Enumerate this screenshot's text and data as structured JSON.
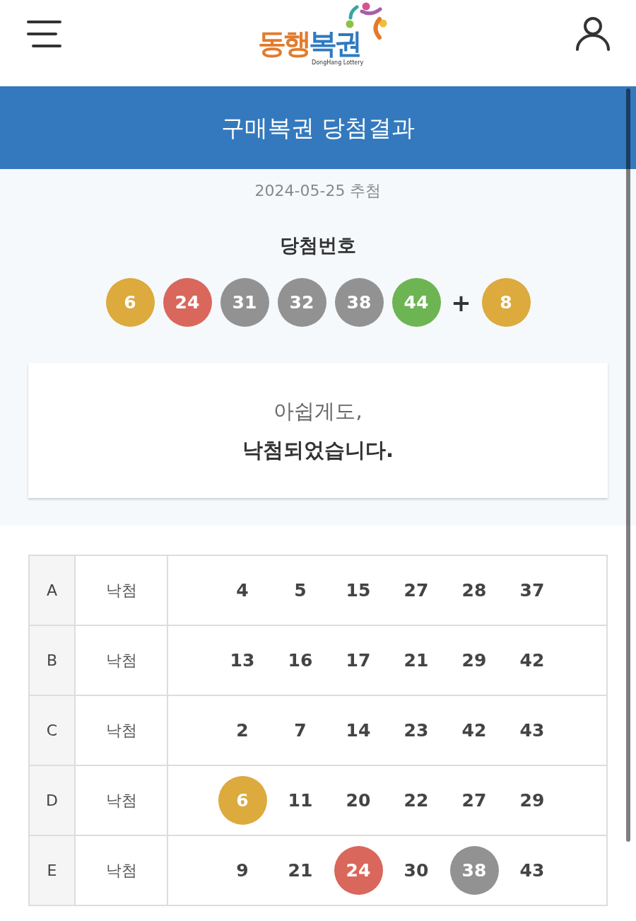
{
  "header": {
    "logo": {
      "wordmark": [
        {
          "text": "동행",
          "color": "#e27b2c"
        },
        {
          "text": "복권",
          "color": "#2f7ac1"
        }
      ],
      "subtitle": "DongHang Lottery"
    }
  },
  "page_title": "구매복권 당첨결과",
  "draw": {
    "date": "2024-05-25 추첨",
    "title": "당첨번호",
    "balls": [
      {
        "number": "6",
        "color": "#dcaa3d"
      },
      {
        "number": "24",
        "color": "#d9675b"
      },
      {
        "number": "31",
        "color": "#929292"
      },
      {
        "number": "32",
        "color": "#929292"
      },
      {
        "number": "38",
        "color": "#929292"
      },
      {
        "number": "44",
        "color": "#6db453"
      }
    ],
    "plus": "+",
    "bonus": {
      "number": "8",
      "color": "#dcaa3d"
    }
  },
  "result_card": {
    "line_1": "아쉽게도,",
    "line_2": "낙첨되었습니다."
  },
  "tickets": [
    {
      "game": "A",
      "result": "낙첨",
      "numbers": [
        {
          "value": "4"
        },
        {
          "value": "5"
        },
        {
          "value": "15"
        },
        {
          "value": "27"
        },
        {
          "value": "28"
        },
        {
          "value": "37"
        }
      ]
    },
    {
      "game": "B",
      "result": "낙첨",
      "numbers": [
        {
          "value": "13"
        },
        {
          "value": "16"
        },
        {
          "value": "17"
        },
        {
          "value": "21"
        },
        {
          "value": "29"
        },
        {
          "value": "42"
        }
      ]
    },
    {
      "game": "C",
      "result": "낙첨",
      "numbers": [
        {
          "value": "2"
        },
        {
          "value": "7"
        },
        {
          "value": "14"
        },
        {
          "value": "23"
        },
        {
          "value": "42"
        },
        {
          "value": "43"
        }
      ]
    },
    {
      "game": "D",
      "result": "낙첨",
      "numbers": [
        {
          "value": "6",
          "color": "#dcaa3d"
        },
        {
          "value": "11"
        },
        {
          "value": "20"
        },
        {
          "value": "22"
        },
        {
          "value": "27"
        },
        {
          "value": "29"
        }
      ]
    },
    {
      "game": "E",
      "result": "낙첨",
      "numbers": [
        {
          "value": "9"
        },
        {
          "value": "21"
        },
        {
          "value": "24",
          "color": "#d9675b"
        },
        {
          "value": "30"
        },
        {
          "value": "38",
          "color": "#929292"
        },
        {
          "value": "43"
        }
      ]
    }
  ]
}
